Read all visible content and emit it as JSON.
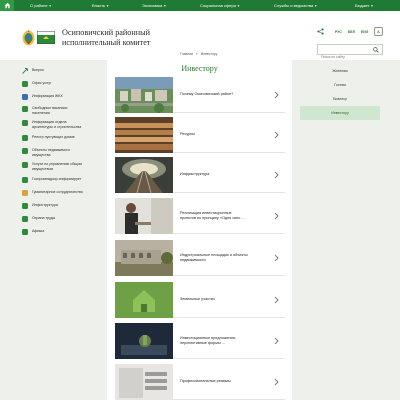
{
  "topnav": {
    "items": [
      {
        "label": "О районе"
      },
      {
        "label": "Власть"
      },
      {
        "label": "Экономика"
      },
      {
        "label": "Социальная сфера"
      },
      {
        "label": "Службы и ведомства"
      },
      {
        "label": "Бюджет"
      }
    ]
  },
  "header": {
    "title_line1": "Осиповичский районный",
    "title_line2": "исполнительный комитет",
    "langs": [
      "РУС",
      "БЕЛ",
      "ENG"
    ],
    "font_size_button": "A",
    "search_placeholder": "Поиск по сайту"
  },
  "breadcrumb": {
    "home": "Главная",
    "separator": "»",
    "current": "Инвестору"
  },
  "sidebar": {
    "items": [
      {
        "label": "Вопрос",
        "label2": ""
      },
      {
        "label": "Офис услуг",
        "label2": ""
      },
      {
        "label": "Информация ЖКХ",
        "label2": ""
      },
      {
        "label": "Свободные вакансии",
        "label2": "населения"
      },
      {
        "label": "Информация отдела",
        "label2": "архитектуры и строительства"
      },
      {
        "label": "Реестр пустующих домов",
        "label2": ""
      },
      {
        "label": "Объекты недвижимого",
        "label2": "имущества"
      },
      {
        "label": "Услуги по управлению общим",
        "label2": "имуществом"
      },
      {
        "label": "Госпромнадзор информирует",
        "label2": ""
      },
      {
        "label": "Гуманитарное сотрудничество",
        "label2": ""
      },
      {
        "label": "Инфоструктура",
        "label2": ""
      },
      {
        "label": "Охрана труда",
        "label2": ""
      },
      {
        "label": "Афиша",
        "label2": ""
      }
    ]
  },
  "main": {
    "title": "Инвестору",
    "cards": [
      {
        "line1": "Почему Осиповичский район?",
        "line2": "",
        "line3": ""
      },
      {
        "line1": "Ресурсы",
        "line2": "",
        "line3": ""
      },
      {
        "line1": "Инфраструктура",
        "line2": "",
        "line3": ""
      },
      {
        "line1": "Реализация инвестиционных",
        "line2": "проектов по принципу «Одно окно ...",
        "line3": ""
      },
      {
        "line1": "Индустриальные площадки и объекты",
        "line2": "недвижимости",
        "line3": ""
      },
      {
        "line1": "Земельные участки",
        "line2": "",
        "line3": ""
      },
      {
        "line1": "Инвестиционные предложения,",
        "line2": "перспективные формы ...",
        "line3": ""
      },
      {
        "line1": "Профессиональные резюмы",
        "line2": "",
        "line3": ""
      }
    ]
  },
  "rside": {
    "items": [
      {
        "label": "Жителям"
      },
      {
        "label": "Гостям"
      },
      {
        "label": "Бизнесу"
      },
      {
        "label": "Инвестору"
      }
    ]
  }
}
